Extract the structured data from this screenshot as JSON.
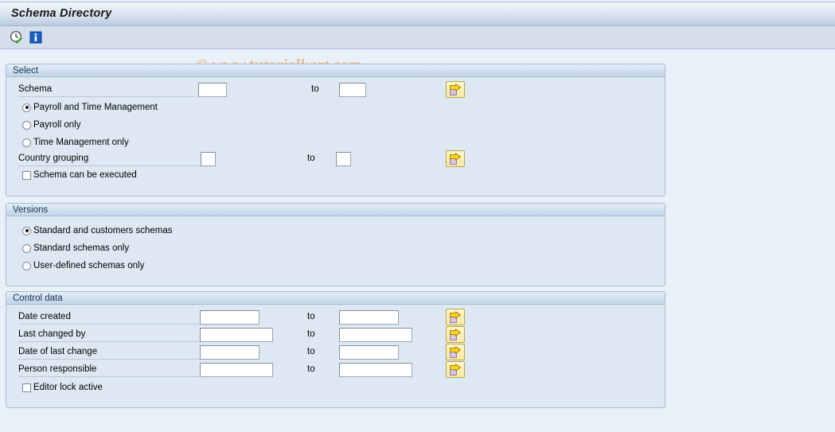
{
  "window": {
    "title": "Schema Directory"
  },
  "toolbar": {
    "icons": [
      {
        "name": "execute-icon",
        "label": "Execute"
      },
      {
        "name": "info-icon",
        "label": "Information"
      }
    ]
  },
  "watermark": {
    "text": "© www.tutorialkart.com",
    "color": "#e8b98a"
  },
  "labels": {
    "to": "to"
  },
  "select_group": {
    "title": "Select",
    "schema": {
      "label": "Schema",
      "from_value": "",
      "to_value": "",
      "multi_select_label": "Multiple selection"
    },
    "scope_options": [
      {
        "label": "Payroll and Time Management",
        "selected": true
      },
      {
        "label": "Payroll only",
        "selected": false
      },
      {
        "label": "Time Management only",
        "selected": false
      }
    ],
    "country_grouping": {
      "label": "Country grouping",
      "from_value": "",
      "to_value": "",
      "multi_select_label": "Multiple selection"
    },
    "executable_checkbox": {
      "label": "Schema can be executed",
      "checked": false
    }
  },
  "versions_group": {
    "title": "Versions",
    "options": [
      {
        "label": "Standard and customers schemas",
        "selected": true
      },
      {
        "label": "Standard schemas only",
        "selected": false
      },
      {
        "label": "User-defined schemas only",
        "selected": false
      }
    ]
  },
  "control_group": {
    "title": "Control data",
    "rows": [
      {
        "label": "Date created",
        "from_value": "",
        "to_value": "",
        "multi_select_label": "Multiple selection"
      },
      {
        "label": "Last changed by",
        "from_value": "",
        "to_value": "",
        "multi_select_label": "Multiple selection"
      },
      {
        "label": "Date of last change",
        "from_value": "",
        "to_value": "",
        "multi_select_label": "Multiple selection"
      },
      {
        "label": "Person responsible",
        "from_value": "",
        "to_value": "",
        "multi_select_label": "Multiple selection"
      }
    ],
    "editor_lock_checkbox": {
      "label": "Editor lock active",
      "checked": false
    }
  }
}
